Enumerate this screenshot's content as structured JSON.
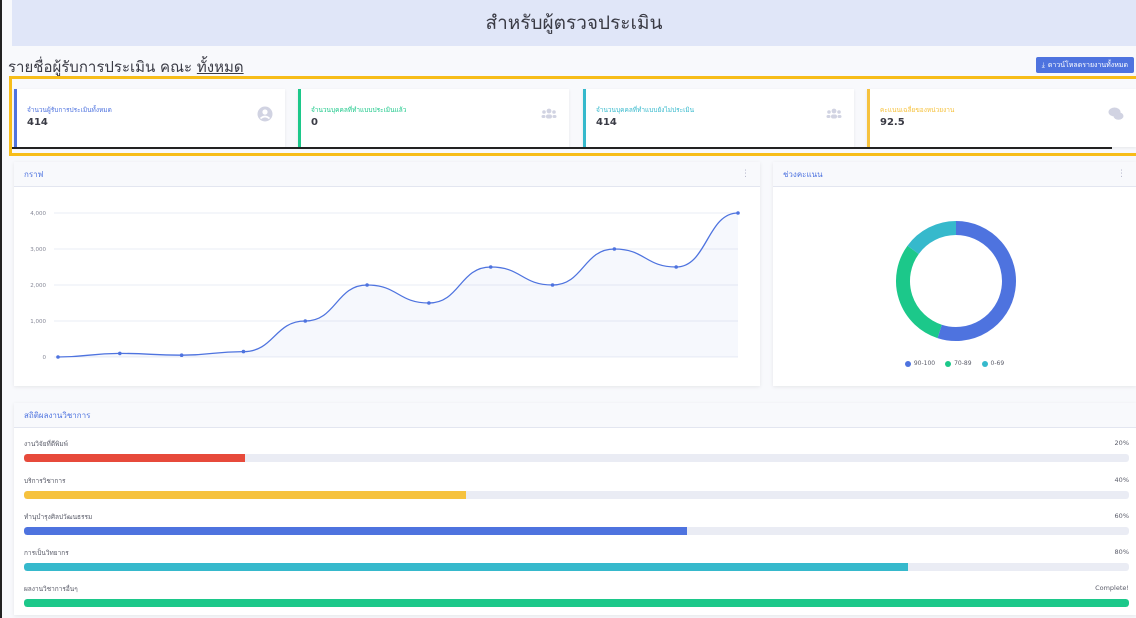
{
  "header": {
    "title": "สำหรับผู้ตรวจประเมิน"
  },
  "subline": {
    "prefix": "รายชื่อผู้รับการประเมิน คณะ",
    "link": "ทั้งหมด"
  },
  "download_button": {
    "label": "ดาวน์โหลดรายงานทั้งหมด"
  },
  "cards": [
    {
      "label": "จำนวนผู้รับการประเมินทั้งหมด",
      "value": "414",
      "icon": "user-circle-icon",
      "color": "#4e73df"
    },
    {
      "label": "จำนวนบุคคลที่ทำแบบประเมินแล้ว",
      "value": "0",
      "icon": "users-icon",
      "color": "#1cc88a"
    },
    {
      "label": "จำนวนบุคคลที่ทำแบบยังไม่ประเมิน",
      "value": "414",
      "icon": "users-icon",
      "color": "#36b9cc"
    },
    {
      "label": "คะแนนเฉลี่ยของหน่วยงาน",
      "value": "92.5",
      "icon": "comments-icon",
      "color": "#f6c23e"
    }
  ],
  "graph_panel": {
    "title": "กราฟ"
  },
  "score_panel": {
    "title": "ช่วงคะแนน"
  },
  "chart_data": [
    {
      "type": "line",
      "x": [
        0,
        1,
        2,
        3,
        4,
        5,
        6,
        7,
        8,
        9,
        10,
        11
      ],
      "values": [
        0,
        100,
        50,
        150,
        1000,
        2000,
        1500,
        2500,
        2000,
        3000,
        2500,
        4000
      ],
      "yticks": [
        "0",
        "1,000",
        "2,000",
        "3,000",
        "4,000"
      ],
      "ylim": [
        0,
        4000
      ],
      "grid": true,
      "color": "#4e73df"
    },
    {
      "type": "pie",
      "style": "doughnut",
      "categories": [
        "90-100",
        "70-89",
        "0-69"
      ],
      "values": [
        55,
        30,
        15
      ],
      "colors": [
        "#4e73df",
        "#1cc88a",
        "#36b9cc"
      ],
      "legend": "bottom"
    }
  ],
  "stats_panel": {
    "title": "สถิติผลงานวิชาการ",
    "rows": [
      {
        "label": "งานวิจัยที่ตีพิมพ์",
        "pct_label": "20%",
        "pct": 20,
        "color": "#e74a3b"
      },
      {
        "label": "บริการวิชาการ",
        "pct_label": "40%",
        "pct": 40,
        "color": "#f6c23e"
      },
      {
        "label": "ทำนุบำรุงศิลปวัฒนธรรม",
        "pct_label": "60%",
        "pct": 60,
        "color": "#4e73df"
      },
      {
        "label": "การเป็นวิทยากร",
        "pct_label": "80%",
        "pct": 80,
        "color": "#36b9cc"
      },
      {
        "label": "ผลงานวิชาการอื่นๆ",
        "pct_label": "Complete!",
        "pct": 100,
        "color": "#1cc88a"
      }
    ]
  }
}
